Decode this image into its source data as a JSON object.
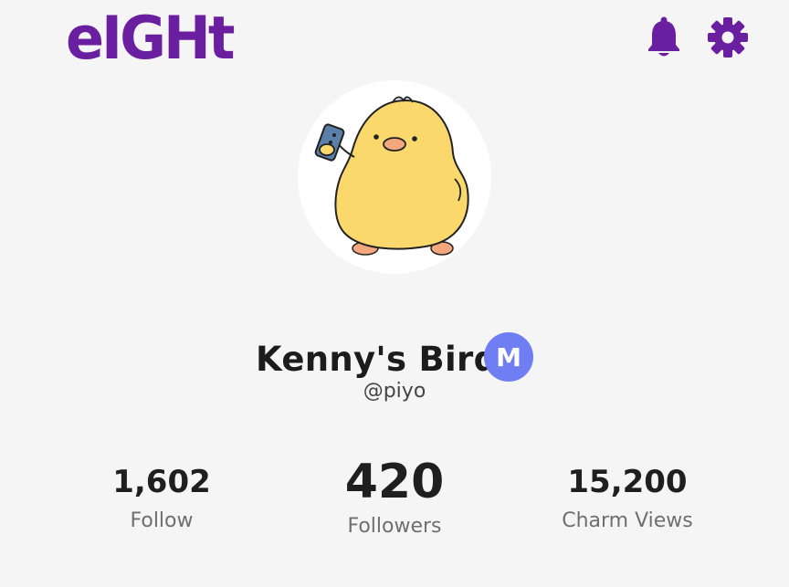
{
  "app": {
    "logo_text": "eIGHt",
    "brand_color": "#6a1fa0"
  },
  "header": {
    "icons": [
      "bell-icon",
      "gear-icon"
    ]
  },
  "profile": {
    "display_name": "Kenny's Bird",
    "handle": "@piyo",
    "badge_letter": "M",
    "badge_color": "#6f7ef2",
    "avatar": "yellow-chick-holding-phone"
  },
  "stats": {
    "follow": {
      "value": "1,602",
      "label": "Follow"
    },
    "followers": {
      "value": "420",
      "label": "Followers"
    },
    "charm_views": {
      "value": "15,200",
      "label": "Charm Views"
    }
  }
}
